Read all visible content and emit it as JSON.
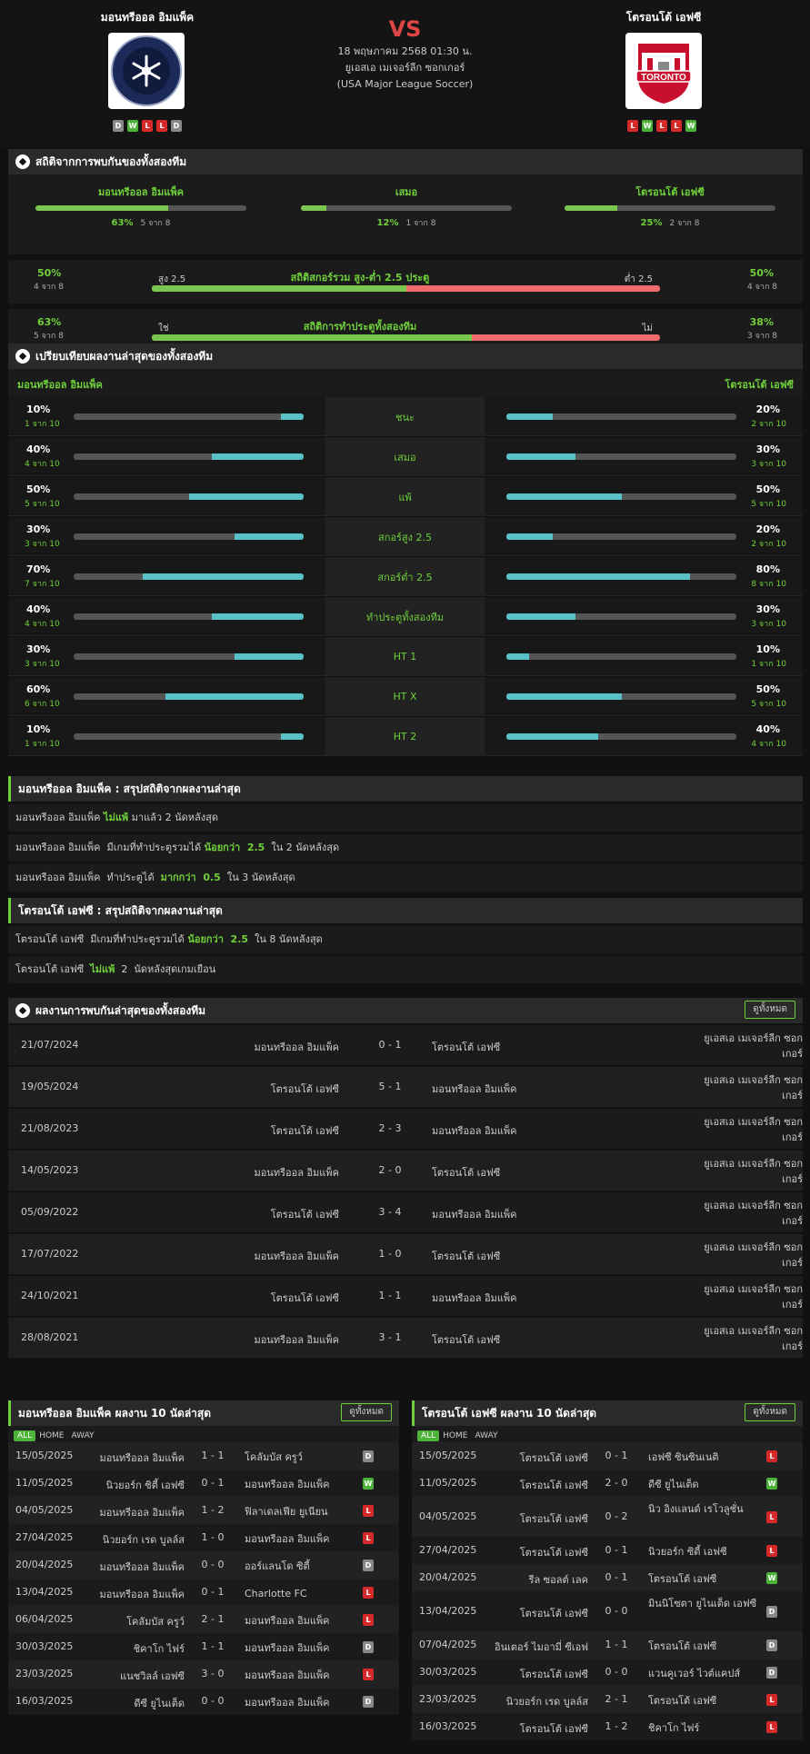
{
  "header": {
    "home": "มอนทรีออล อิมแพ็ค",
    "away": "โตรอนโต้ เอฟซี",
    "vs": "VS",
    "date": "18 พฤษภาคม 2568 01:30 น.",
    "league": "ยูเอสเอ เมเจอร์ลีก ซอกเกอร์ (USA Major League Soccer)",
    "home_form": [
      "D",
      "W",
      "L",
      "L",
      "D"
    ],
    "away_form": [
      "L",
      "W",
      "L",
      "L",
      "W"
    ],
    "home_logo_icon": "montreal-impact-crest-icon",
    "away_logo_icon": "toronto-fc-crest-icon"
  },
  "h2h_stats": {
    "title": "สถิติจากการพบกันของทั้งสองทีม",
    "cols": [
      {
        "label": "มอนทรีออล อิมแพ็ค",
        "pct": "63%",
        "sub": "5 จาก 8",
        "fill": 0.63
      },
      {
        "label": "เสมอ",
        "pct": "12%",
        "sub": "1 จาก 8",
        "fill": 0.12
      },
      {
        "label": "โตรอนโต้ เอฟซี",
        "pct": "25%",
        "sub": "2 จาก 8",
        "fill": 0.25
      }
    ],
    "goals": {
      "title": "สถิติสกอร์รวม สูง-ต่ำ 2.5 ประตู",
      "left_pct": "50%",
      "left_sub": "4 จาก 8",
      "right_pct": "50%",
      "right_sub": "4 จาก 8",
      "left_label": "สูง 2.5",
      "right_label": "ต่ำ 2.5",
      "fill": 0.5
    },
    "btts": {
      "title": "สถิติการทำประตูทั้งสองทีม",
      "left_pct": "63%",
      "left_sub": "5 จาก 8",
      "right_pct": "38%",
      "right_sub": "3 จาก 8",
      "left_label": "ใช่",
      "right_label": "ไม่",
      "fill": 0.63
    }
  },
  "compare": {
    "title": "เปรียบเทียบผลงานล่าสุดของทั้งสองทีม",
    "home": "มอนทรีออล อิมแพ็ค",
    "away": "โตรอนโต้ เอฟซี",
    "rows": [
      {
        "label": "ชนะ",
        "l_pct": "10%",
        "l_sub": "1 จาก 10",
        "l": 0.1,
        "r_pct": "20%",
        "r_sub": "2 จาก 10",
        "r": 0.2
      },
      {
        "label": "เสมอ",
        "l_pct": "40%",
        "l_sub": "4 จาก 10",
        "l": 0.4,
        "r_pct": "30%",
        "r_sub": "3 จาก 10",
        "r": 0.3
      },
      {
        "label": "แพ้",
        "l_pct": "50%",
        "l_sub": "5 จาก 10",
        "l": 0.5,
        "r_pct": "50%",
        "r_sub": "5 จาก 10",
        "r": 0.5
      },
      {
        "label": "สกอร์สูง 2.5",
        "l_pct": "30%",
        "l_sub": "3 จาก 10",
        "l": 0.3,
        "r_pct": "20%",
        "r_sub": "2 จาก 10",
        "r": 0.2
      },
      {
        "label": "สกอร์ต่ำ 2.5",
        "l_pct": "70%",
        "l_sub": "7 จาก 10",
        "l": 0.7,
        "r_pct": "80%",
        "r_sub": "8 จาก 10",
        "r": 0.8
      },
      {
        "label": "ทำประตูทั้งสองทีม",
        "l_pct": "40%",
        "l_sub": "4 จาก 10",
        "l": 0.4,
        "r_pct": "30%",
        "r_sub": "3 จาก 10",
        "r": 0.3
      },
      {
        "label": "HT 1",
        "l_pct": "30%",
        "l_sub": "3 จาก 10",
        "l": 0.3,
        "r_pct": "10%",
        "r_sub": "1 จาก 10",
        "r": 0.1
      },
      {
        "label": "HT X",
        "l_pct": "60%",
        "l_sub": "6 จาก 10",
        "l": 0.6,
        "r_pct": "50%",
        "r_sub": "5 จาก 10",
        "r": 0.5
      },
      {
        "label": "HT 2",
        "l_pct": "10%",
        "l_sub": "1 จาก 10",
        "l": 0.1,
        "r_pct": "40%",
        "r_sub": "4 จาก 10",
        "r": 0.4
      }
    ]
  },
  "summary_home": {
    "title": "มอนทรีออล อิมแพ็ค : สรุปสถิติจากผลงานล่าสุด",
    "lines": [
      [
        {
          "t": "มอนทรีออล อิมแพ็ค "
        },
        {
          "t": "ไม่แพ้",
          "hl": true
        },
        {
          "t": " มาแล้ว 2 นัดหลังสุด"
        }
      ],
      [
        {
          "t": "มอนทรีออล อิมแพ็ค  มีเกมที่ทำประตูรวมได้ "
        },
        {
          "t": "น้อยกว่า  2.5",
          "hl": true
        },
        {
          "t": "  ใน 2 นัดหลังสุด"
        }
      ],
      [
        {
          "t": "มอนทรีออล อิมแพ็ค  ทำประตูได้  "
        },
        {
          "t": "มากกว่า  0.5",
          "hl": true
        },
        {
          "t": "  ใน 3 นัดหลังสุด"
        }
      ]
    ]
  },
  "summary_away": {
    "title": "โตรอนโต้ เอฟซี : สรุปสถิติจากผลงานล่าสุด",
    "lines": [
      [
        {
          "t": "โตรอนโต้ เอฟซี  มีเกมที่ทำประตูรวมได้ "
        },
        {
          "t": "น้อยกว่า  2.5",
          "hl": true
        },
        {
          "t": "  ใน 8 นัดหลังสุด"
        }
      ],
      [
        {
          "t": "โตรอนโต้ เอฟซี  "
        },
        {
          "t": "ไม่แพ้",
          "hl": true
        },
        {
          "t": "  2  นัดหลังสุดเกมเยือน"
        }
      ]
    ]
  },
  "h2h_results": {
    "title": "ผลงานการพบกันล่าสุดของทั้งสองทีม",
    "see_all": "ดูทั้งหมด",
    "rows": [
      {
        "date": "21/07/2024",
        "home": "มอนทรีออล อิมแพ็ค",
        "score": "0 - 1",
        "away": "โตรอนโต้ เอฟซี",
        "league": "ยูเอสเอ เมเจอร์ลีก ซอกเกอร์"
      },
      {
        "date": "19/05/2024",
        "home": "โตรอนโต้ เอฟซี",
        "score": "5 - 1",
        "away": "มอนทรีออล อิมแพ็ค",
        "league": "ยูเอสเอ เมเจอร์ลีก ซอกเกอร์"
      },
      {
        "date": "21/08/2023",
        "home": "โตรอนโต้ เอฟซี",
        "score": "2 - 3",
        "away": "มอนทรีออล อิมแพ็ค",
        "league": "ยูเอสเอ เมเจอร์ลีก ซอกเกอร์"
      },
      {
        "date": "14/05/2023",
        "home": "มอนทรีออล อิมแพ็ค",
        "score": "2 - 0",
        "away": "โตรอนโต้ เอฟซี",
        "league": "ยูเอสเอ เมเจอร์ลีก ซอกเกอร์"
      },
      {
        "date": "05/09/2022",
        "home": "โตรอนโต้ เอฟซี",
        "score": "3 - 4",
        "away": "มอนทรีออล อิมแพ็ค",
        "league": "ยูเอสเอ เมเจอร์ลีก ซอกเกอร์"
      },
      {
        "date": "17/07/2022",
        "home": "มอนทรีออล อิมแพ็ค",
        "score": "1 - 0",
        "away": "โตรอนโต้ เอฟซี",
        "league": "ยูเอสเอ เมเจอร์ลีก ซอกเกอร์"
      },
      {
        "date": "24/10/2021",
        "home": "โตรอนโต้ เอฟซี",
        "score": "1 - 1",
        "away": "มอนทรีออล อิมแพ็ค",
        "league": "ยูเอสเอ เมเจอร์ลีก ซอกเกอร์"
      },
      {
        "date": "28/08/2021",
        "home": "มอนทรีออล อิมแพ็ค",
        "score": "3 - 1",
        "away": "โตรอนโต้ เอฟซี",
        "league": "ยูเอสเอ เมเจอร์ลีก ซอกเกอร์"
      }
    ]
  },
  "last10_home": {
    "title": "มอนทรีออล อิมแพ็ค ผลงาน 10 นัดล่าสุด",
    "see_all": "ดูทั้งหมด",
    "tabs": [
      "ALL",
      "HOME",
      "AWAY"
    ],
    "rows": [
      {
        "date": "15/05/2025",
        "home": "มอนทรีออล อิมแพ็ค",
        "score": "1 - 1",
        "away": "โคลัมบัส ครูว์",
        "res": "D"
      },
      {
        "date": "11/05/2025",
        "home": "นิวยอร์ก ซิตี้ เอฟซี",
        "score": "0 - 1",
        "away": "มอนทรีออล อิมแพ็ค",
        "res": "W"
      },
      {
        "date": "04/05/2025",
        "home": "มอนทรีออล อิมแพ็ค",
        "score": "1 - 2",
        "away": "ฟิลาเดลเฟีย ยูเนียน",
        "res": "L"
      },
      {
        "date": "27/04/2025",
        "home": "นิวยอร์ก เรด บูลล์ส",
        "score": "1 - 0",
        "away": "มอนทรีออล อิมแพ็ค",
        "res": "L"
      },
      {
        "date": "20/04/2025",
        "home": "มอนทรีออล อิมแพ็ค",
        "score": "0 - 0",
        "away": "ออร์แลนโด ซิตี้",
        "res": "D"
      },
      {
        "date": "13/04/2025",
        "home": "มอนทรีออล อิมแพ็ค",
        "score": "0 - 1",
        "away": "Charlotte FC",
        "res": "L"
      },
      {
        "date": "06/04/2025",
        "home": "โคลัมบัส ครูว์",
        "score": "2 - 1",
        "away": "มอนทรีออล อิมแพ็ค",
        "res": "L"
      },
      {
        "date": "30/03/2025",
        "home": "ชิคาโก ไฟร์",
        "score": "1 - 1",
        "away": "มอนทรีออล อิมแพ็ค",
        "res": "D"
      },
      {
        "date": "23/03/2025",
        "home": "แนชวิลล์ เอฟซี",
        "score": "3 - 0",
        "away": "มอนทรีออล อิมแพ็ค",
        "res": "L"
      },
      {
        "date": "16/03/2025",
        "home": "ดีซี ยูไนเต็ด",
        "score": "0 - 0",
        "away": "มอนทรีออล อิมแพ็ค",
        "res": "D"
      }
    ]
  },
  "last10_away": {
    "title": "โตรอนโต้ เอฟซี ผลงาน 10 นัดล่าสุด",
    "see_all": "ดูทั้งหมด",
    "tabs": [
      "ALL",
      "HOME",
      "AWAY"
    ],
    "rows": [
      {
        "date": "15/05/2025",
        "home": "โตรอนโต้ เอฟซี",
        "score": "0 - 1",
        "away": "เอฟซี ซินซินเนติ",
        "res": "L"
      },
      {
        "date": "11/05/2025",
        "home": "โตรอนโต้ เอฟซี",
        "score": "2 - 0",
        "away": "ดีซี ยูไนเต็ด",
        "res": "W"
      },
      {
        "date": "04/05/2025",
        "home": "โตรอนโต้ เอฟซี",
        "score": "0 - 2",
        "away": "นิว อิงแลนด์ เรโวลูชั่น",
        "res": "L"
      },
      {
        "date": "27/04/2025",
        "home": "โตรอนโต้ เอฟซี",
        "score": "0 - 1",
        "away": "นิวยอร์ก ซิตี้ เอฟซี",
        "res": "L"
      },
      {
        "date": "20/04/2025",
        "home": "รีล ซอลต์ เลค",
        "score": "0 - 1",
        "away": "โตรอนโต้ เอฟซี",
        "res": "W"
      },
      {
        "date": "13/04/2025",
        "home": "โตรอนโต้ เอฟซี",
        "score": "0 - 0",
        "away": "มินนิโซตา ยูไนเต็ด เอฟซี",
        "res": "D"
      },
      {
        "date": "07/04/2025",
        "home": "อินเตอร์ ไมอามี่ ซีเอฟ",
        "score": "1 - 1",
        "away": "โตรอนโต้ เอฟซี",
        "res": "D"
      },
      {
        "date": "30/03/2025",
        "home": "โตรอนโต้ เอฟซี",
        "score": "0 - 0",
        "away": "แวนคูเวอร์ ไวต์แคปส์",
        "res": "D"
      },
      {
        "date": "23/03/2025",
        "home": "นิวยอร์ก เรด บูลล์ส",
        "score": "2 - 1",
        "away": "โตรอนโต้ เอฟซี",
        "res": "L"
      },
      {
        "date": "16/03/2025",
        "home": "โตรอนโต้ เอฟซี",
        "score": "1 - 2",
        "away": "ชิคาโก ไฟร์",
        "res": "L"
      }
    ]
  }
}
